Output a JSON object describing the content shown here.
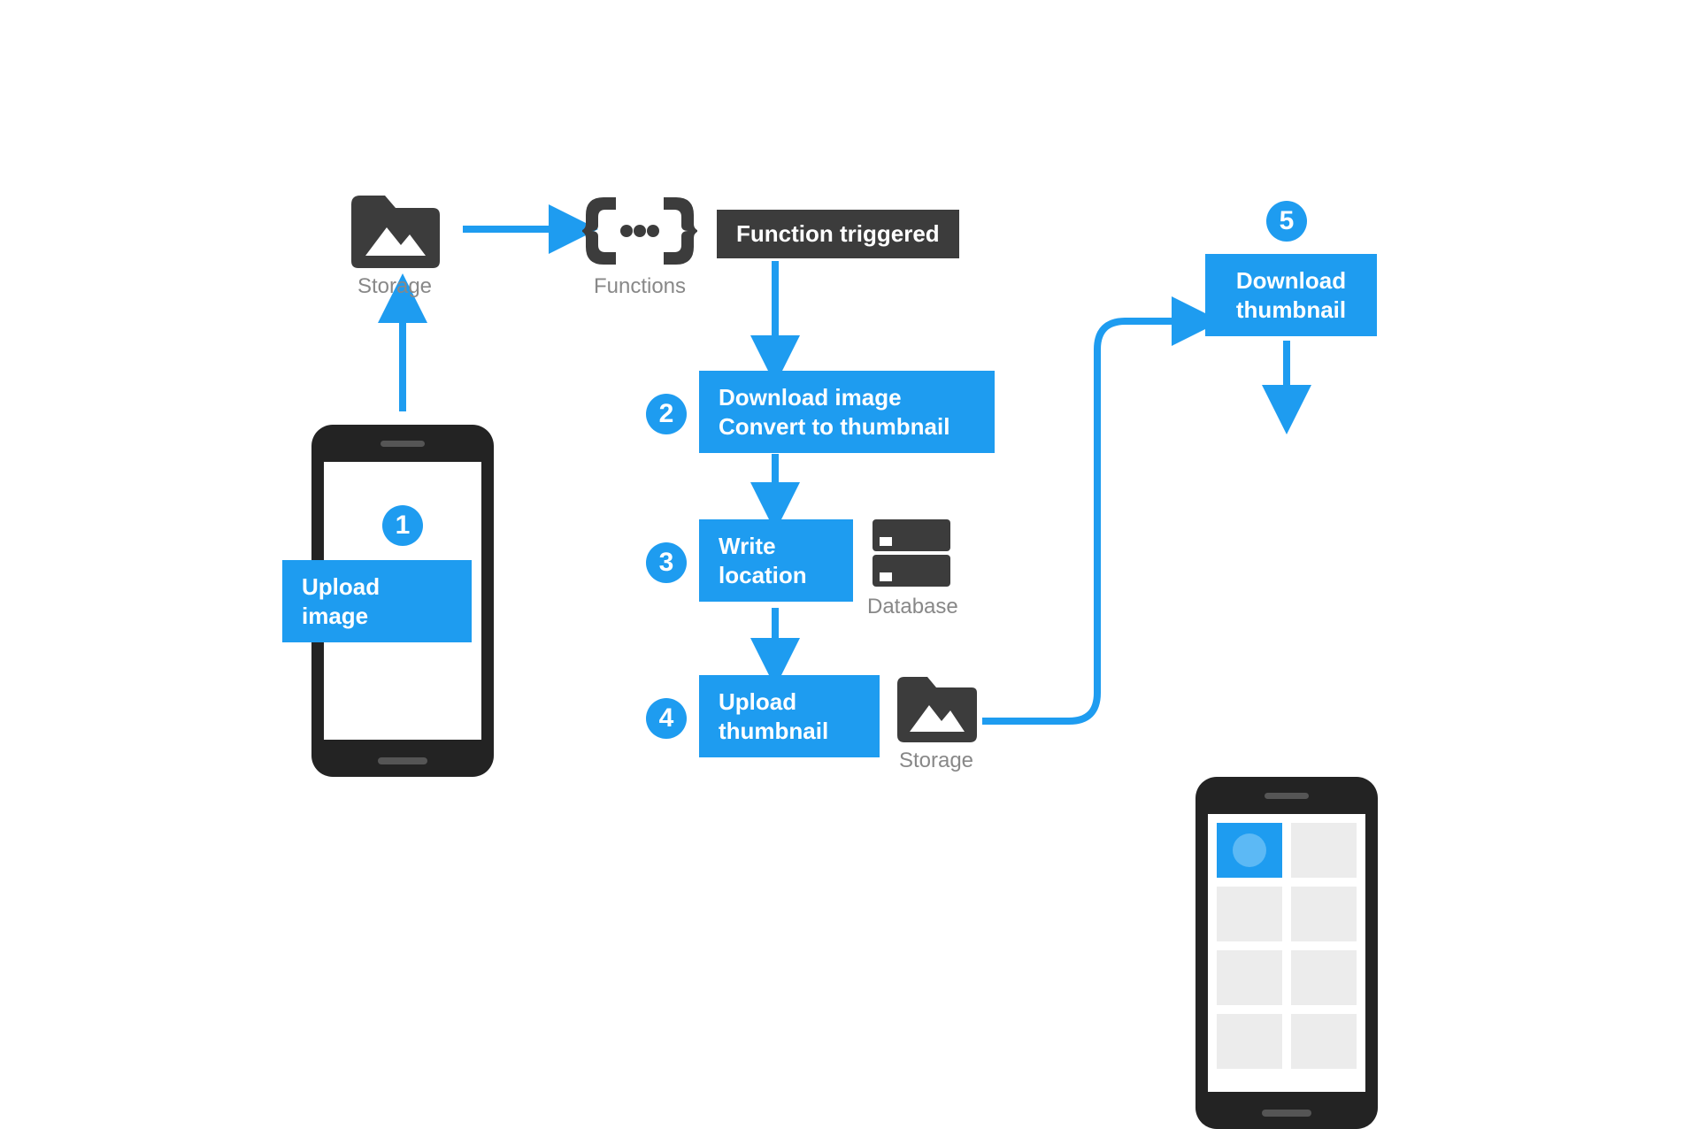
{
  "icons": {
    "storage_label": "Storage",
    "functions_label": "Functions",
    "database_label": "Database",
    "storage2_label": "Storage"
  },
  "steps": {
    "s1": {
      "num": "1",
      "label": "Upload\nimage"
    },
    "trigger_label": "Function triggered",
    "s2": {
      "num": "2",
      "label": "Download image\nConvert to thumbnail"
    },
    "s3": {
      "num": "3",
      "label": "Write\nlocation"
    },
    "s4": {
      "num": "4",
      "label": "Upload\nthumbnail"
    },
    "s5": {
      "num": "5",
      "label": "Download\nthumbnail"
    }
  },
  "colors": {
    "accent": "#1e9cf0",
    "dark": "#3c3c3c",
    "muted": "#888888"
  }
}
